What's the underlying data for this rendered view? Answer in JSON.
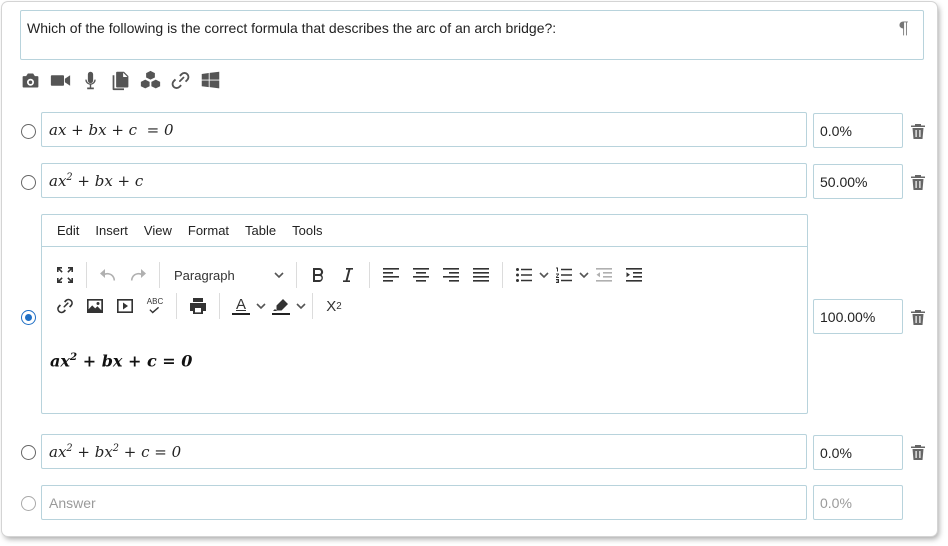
{
  "question": {
    "text": "Which of the following is the correct formula that describes the arc of an arch bridge?:",
    "paragraph_mark": "¶"
  },
  "media_icons": [
    "camera-icon",
    "video-icon",
    "microphone-icon",
    "copy-icon",
    "blocks-icon",
    "link-icon",
    "windows-icon"
  ],
  "answers": [
    {
      "formula_html": "ax + bx + c &nbsp;= 0",
      "percent": "0.0%",
      "selected": false
    },
    {
      "formula_html": "ax<sup>2</sup> + bx + c",
      "percent": "50.00%",
      "selected": false
    },
    {
      "formula_html": "ax<sup>2</sup> + bx + c = 0",
      "percent": "100.00%",
      "selected": true
    },
    {
      "formula_html": "ax<sup>2</sup> + bx<sup>2</sup> + c = 0",
      "percent": "0.0%",
      "selected": false
    }
  ],
  "new_answer": {
    "placeholder": "Answer",
    "percent_placeholder": "0.0%"
  },
  "editor": {
    "menu": [
      "Edit",
      "Insert",
      "View",
      "Format",
      "Table",
      "Tools"
    ],
    "block_format": "Paragraph",
    "content": "ax² + bx + c = 0",
    "text_color_label": "A",
    "superscript_label": "X²",
    "spellcheck_label": "ABC"
  },
  "colors": {
    "border": "#b8d3dc",
    "selected_radio": "#1f6fc5",
    "icon": "#555555"
  }
}
